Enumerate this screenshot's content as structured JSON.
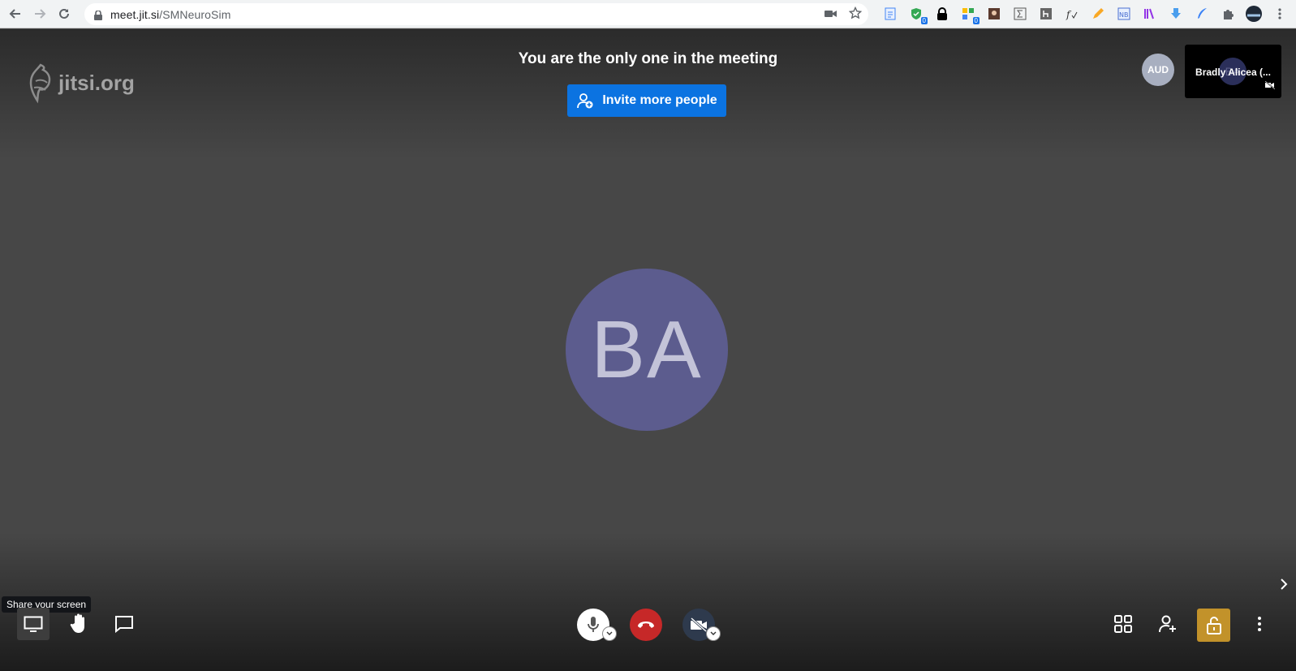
{
  "browser": {
    "url_host": "meet.jit.si",
    "url_path": "/SMNeuroSim",
    "extensions": [
      {
        "icon": "doc-icon",
        "badge": ""
      },
      {
        "icon": "shield-check-icon",
        "badge": "0"
      },
      {
        "icon": "lock-ext-icon",
        "badge": ""
      },
      {
        "icon": "puzzle-color-icon",
        "badge": "0"
      },
      {
        "icon": "portrait-icon",
        "badge": ""
      },
      {
        "icon": "sigma-icon",
        "badge": ""
      },
      {
        "icon": "h-icon",
        "badge": ""
      },
      {
        "icon": "fx-icon",
        "badge": ""
      },
      {
        "icon": "pencil-icon",
        "badge": ""
      },
      {
        "icon": "nb-icon",
        "badge": ""
      },
      {
        "icon": "library-icon",
        "badge": ""
      },
      {
        "icon": "download-icon",
        "badge": ""
      },
      {
        "icon": "quill-icon",
        "badge": ""
      },
      {
        "icon": "puzzle-icon",
        "badge": ""
      }
    ]
  },
  "meeting": {
    "logo_text": "jitsi.org",
    "notice": "You are the only one in the meeting",
    "invite_label": "Invite more people",
    "aud_label": "AUD",
    "thumbnail_initials": "BA",
    "thumbnail_name": "Bradly Alicea (...",
    "main_initials": "BA",
    "avatar_color": "#5c5c8e"
  },
  "toolbar": {
    "tooltip": "Share your screen",
    "accent_hangup": "#c62828",
    "accent_lock": "#c2922a",
    "accent_invite": "#0b73e1"
  }
}
